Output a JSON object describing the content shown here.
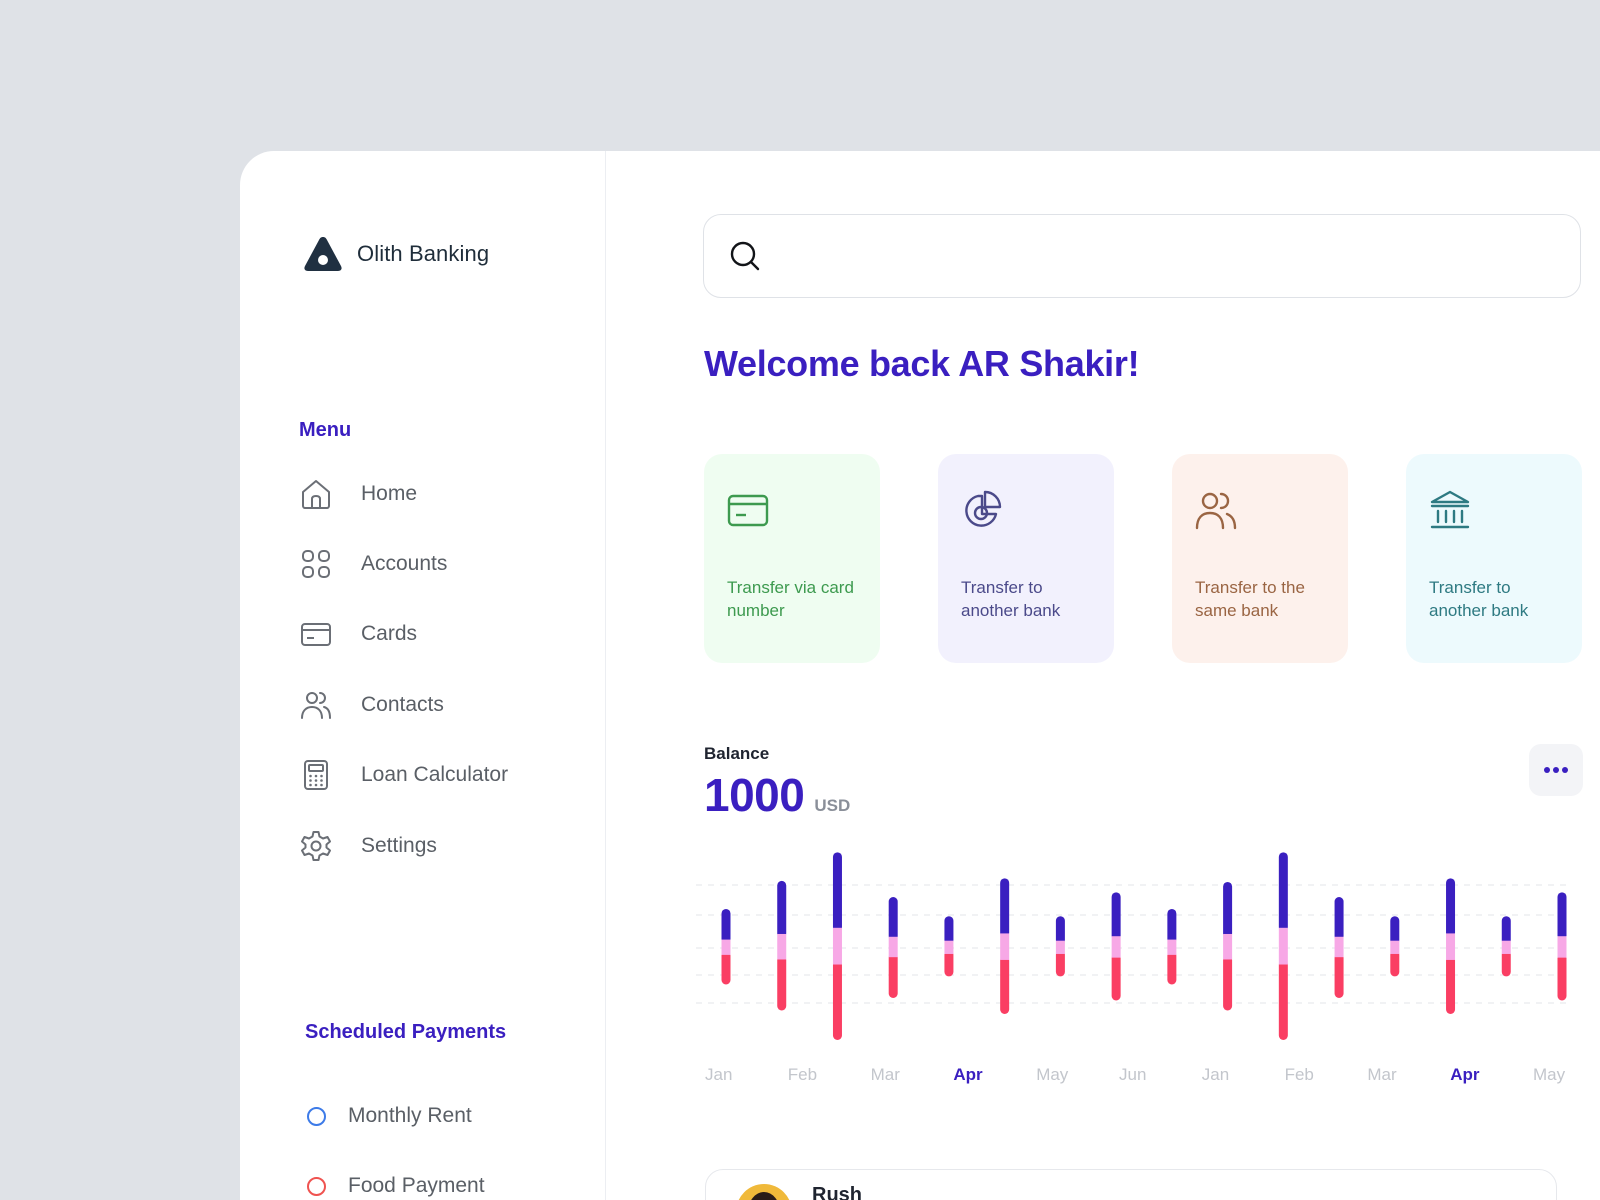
{
  "brand": {
    "name": "Olith Banking"
  },
  "menu": {
    "title": "Menu",
    "items": [
      {
        "label": "Home",
        "icon": "home-icon"
      },
      {
        "label": "Accounts",
        "icon": "grid-icon"
      },
      {
        "label": "Cards",
        "icon": "card-icon"
      },
      {
        "label": "Contacts",
        "icon": "users-icon"
      },
      {
        "label": "Loan Calculator",
        "icon": "calculator-icon"
      },
      {
        "label": "Settings",
        "icon": "gear-icon"
      }
    ]
  },
  "scheduled": {
    "title": "Scheduled Payments",
    "items": [
      {
        "label": "Monthly Rent",
        "color": "#3d7be8"
      },
      {
        "label": "Food Payment",
        "color": "#ef5350"
      }
    ]
  },
  "search": {
    "placeholder": ""
  },
  "welcome": "Welcome back AR Shakir!",
  "quick_actions": [
    {
      "label": "Transfer via card number",
      "icon": "card-icon",
      "bg": "#effdf1",
      "color": "#3d9a4f"
    },
    {
      "label": "Transfer to another bank",
      "icon": "pie-chart-icon",
      "bg": "#f2f1fd",
      "color": "#4b4a8a"
    },
    {
      "label": "Transfer to the same bank",
      "icon": "users-icon",
      "bg": "#fdf1ec",
      "color": "#9a6543"
    },
    {
      "label": "Transfer to another bank",
      "icon": "bank-icon",
      "bg": "#edfafd",
      "color": "#2e7a82"
    }
  ],
  "balance": {
    "label": "Balance",
    "value": "1000",
    "unit": "USD"
  },
  "colors": {
    "accent": "#3a1fc0",
    "pink_light": "#f7a8e6",
    "red": "#fa3e63"
  },
  "chart_data": {
    "type": "bar",
    "stacked": true,
    "categories": [
      "Jan",
      "",
      "Feb",
      "",
      "Mar",
      "",
      "Apr",
      "",
      "May",
      "",
      "Jun",
      "",
      "Jan",
      "",
      "Feb",
      "",
      "Mar",
      "",
      "Apr",
      "",
      "May",
      ""
    ],
    "tick_labels": [
      "Jan",
      "Feb",
      "Mar",
      "Apr",
      "May",
      "Jun",
      "Jan",
      "Feb",
      "Mar",
      "Apr",
      "May"
    ],
    "highlighted_ticks": [
      "Apr"
    ],
    "series": [
      {
        "values": [
          3.0,
          5.2,
          7.4,
          3.9,
          2.4,
          5.4,
          2.4,
          4.3,
          3.0,
          5.1,
          7.4,
          3.9,
          2.4,
          5.4,
          2.4,
          4.3
        ]
      },
      {
        "values": [
          1.5,
          2.5,
          3.6,
          2.0,
          1.3,
          2.6,
          1.3,
          2.1,
          1.5,
          2.5,
          3.6,
          2.0,
          1.3,
          2.6,
          1.3,
          2.1
        ]
      },
      {
        "values": [
          2.9,
          5.0,
          7.4,
          4.0,
          2.2,
          5.3,
          2.2,
          4.2,
          2.9,
          5.0,
          7.4,
          4.0,
          2.2,
          5.3,
          2.2,
          4.2
        ]
      }
    ],
    "grid": true
  },
  "contact_preview": {
    "name": "Rush"
  }
}
